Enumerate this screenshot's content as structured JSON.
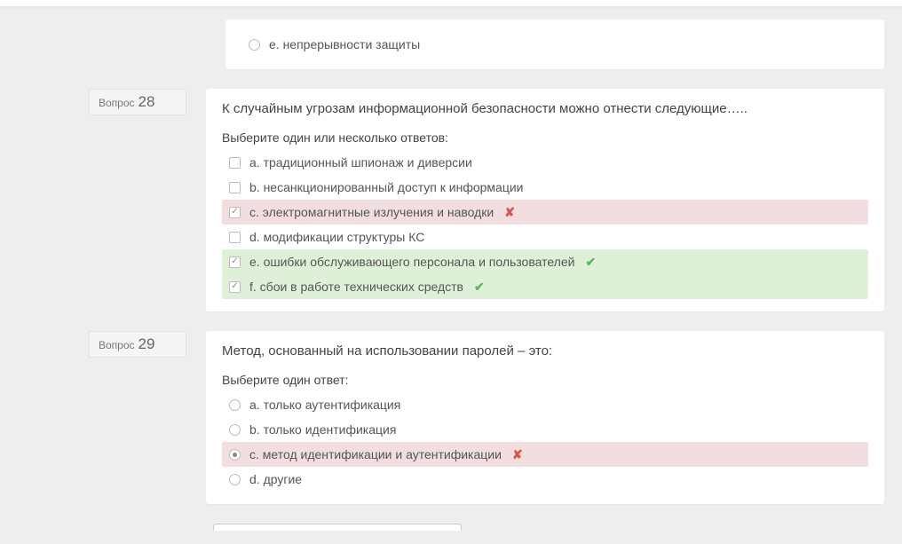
{
  "q0": {
    "options": {
      "e": {
        "label": "e. непрерывности защиты"
      }
    }
  },
  "q28": {
    "label_word": "Вопрос",
    "label_num": "28",
    "text": "К случайным угрозам информационной безопасности можно отнести следующие…..",
    "prompt": "Выберите один или несколько ответов:",
    "options": {
      "a": {
        "label": "a. традиционный шпионаж и диверсии"
      },
      "b": {
        "label": "b. несанкционированный доступ к информации"
      },
      "c": {
        "label": "c. электромагнитные излучения и наводки"
      },
      "d": {
        "label": "d. модификации структуры КС"
      },
      "e": {
        "label": "e. ошибки обслуживающего персонала и пользователей"
      },
      "f": {
        "label": "f. сбои в работе технических средств"
      }
    }
  },
  "q29": {
    "label_word": "Вопрос",
    "label_num": "29",
    "text": "Метод, основанный на использовании паролей – это:",
    "prompt": "Выберите один ответ:",
    "options": {
      "a": {
        "label": "a. только аутентификация"
      },
      "b": {
        "label": "b. только идентификация"
      },
      "c": {
        "label": "c. метод идентификации и аутентификации"
      },
      "d": {
        "label": "d. другие"
      }
    }
  },
  "marks": {
    "x": "✘",
    "v": "✔"
  }
}
